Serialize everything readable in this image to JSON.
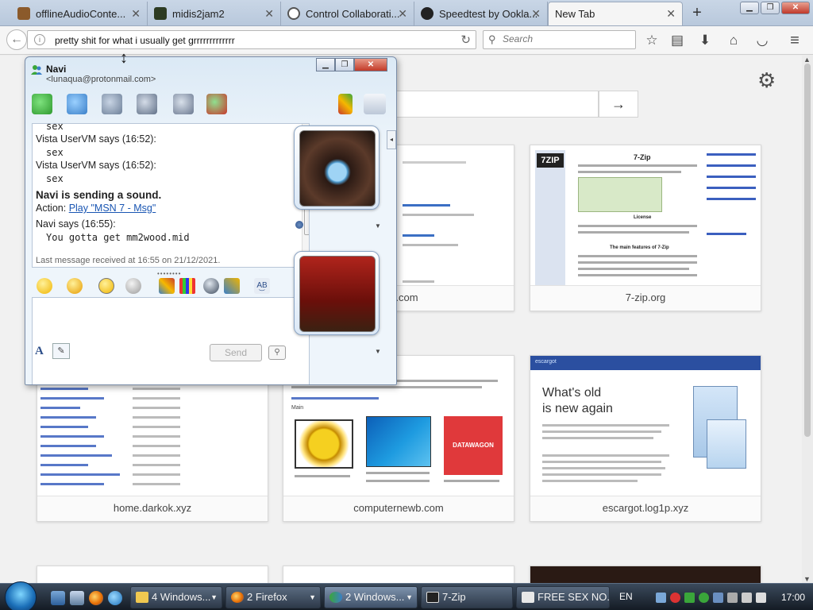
{
  "browser": {
    "tabs": [
      {
        "title": "offlineAudioConte...",
        "active": false
      },
      {
        "title": "midis2jam2",
        "active": false
      },
      {
        "title": "Control Collaborati...",
        "active": false
      },
      {
        "title": "Speedtest by Ookla...",
        "active": false
      },
      {
        "title": "New Tab",
        "active": true
      }
    ],
    "url_value": "pretty shit for what i usually get grrrrrrrrrrrrr",
    "search_placeholder": "Search"
  },
  "newtab": {
    "tiles": [
      {
        "label": "...le.com"
      },
      {
        "label": "7-zip.org"
      },
      {
        "label": "home.darkok.xyz"
      },
      {
        "label": "computernewb.com"
      },
      {
        "label": "escargot.log1p.xyz"
      }
    ],
    "sevenzip_thumb": {
      "logo": "7ZIP",
      "heading": "7-Zip",
      "subheading": "The main features of 7-Zip",
      "license": "License"
    },
    "escargot_thumb": {
      "headline_1": "What's old",
      "headline_2": "is new again",
      "brand": "escargot"
    },
    "computernewb_thumb": {
      "badge": "DATAWAGON",
      "section": "Main"
    }
  },
  "messenger": {
    "contact_name": "Navi",
    "contact_email": "<lunaqua@protonmail.com>",
    "history": [
      {
        "type": "msg",
        "text": "sex"
      },
      {
        "type": "hdr",
        "text": "Vista UserVM says (16:52):"
      },
      {
        "type": "msg",
        "text": "sex"
      },
      {
        "type": "hdr",
        "text": "Vista UserVM says (16:52):"
      },
      {
        "type": "msg",
        "text": "sex"
      }
    ],
    "sound_event": "Navi is sending a sound.",
    "action_prefix": "Action: ",
    "action_link": "Play \"MSN 7 - Msg\"",
    "last_header": "Navi says (16:55):",
    "last_message": "You gotta get mm2wood.mid",
    "footer": "Last message received at 16:55 on 21/12/2021.",
    "send_label": "Send",
    "grip": "••••••••",
    "font_button": "A"
  },
  "taskbar": {
    "buttons": [
      {
        "label": "4 Windows...",
        "active": false
      },
      {
        "label": "2 Firefox",
        "active": false
      },
      {
        "label": "2 Windows...",
        "active": true
      },
      {
        "label": "7-Zip",
        "active": false
      },
      {
        "label": "FREE SEX NO...",
        "active": false
      }
    ],
    "language": "EN",
    "clock": "17:00"
  }
}
